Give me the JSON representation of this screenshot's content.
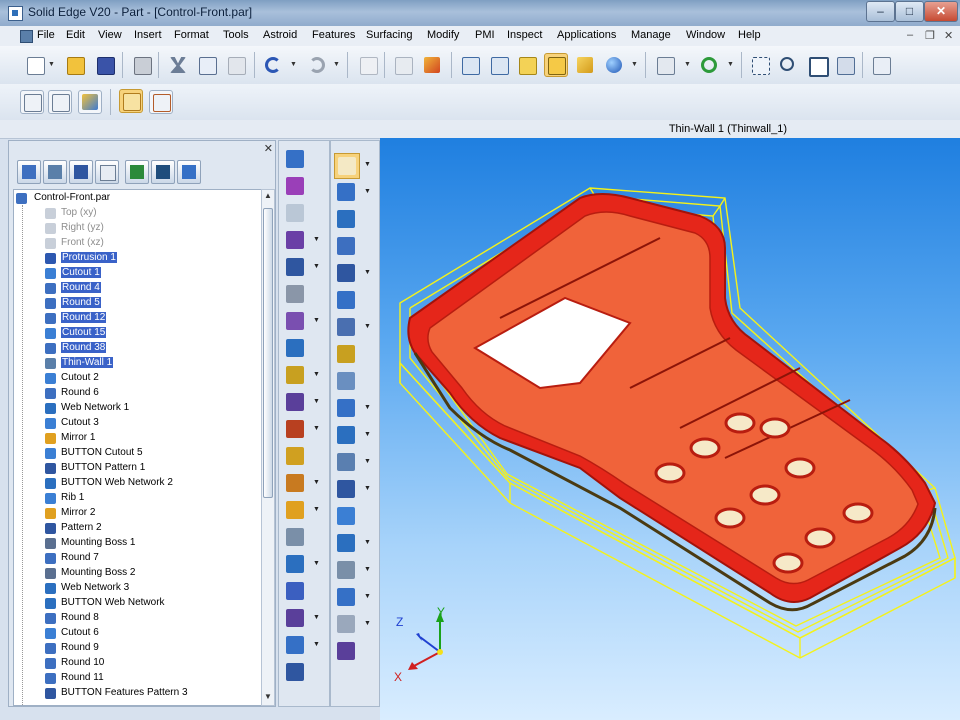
{
  "window": {
    "title": "Solid Edge V20 - Part - [Control-Front.par]",
    "minimize": "–",
    "maximize": "□",
    "close": "✕"
  },
  "menubar": {
    "items": [
      "File",
      "Edit",
      "View",
      "Insert",
      "Format",
      "Tools",
      "Astroid",
      "Features",
      "Surfacing",
      "Modify",
      "PMI",
      "Inspect",
      "Applications",
      "Manage",
      "Window",
      "Help"
    ],
    "mdi_minimize": "–",
    "mdi_restore": "❐",
    "mdi_close": "✕"
  },
  "toolbar_main": {
    "icons": [
      "new-icon",
      "open-icon",
      "save-icon",
      "print-icon",
      "cut-icon",
      "copy-icon",
      "paste-icon",
      "undo-icon",
      "redo-icon",
      "select-icon",
      "part-icon",
      "feature-icon",
      "view-front-icon",
      "view-iso-icon",
      "shaded-icon",
      "shaded-edges-icon",
      "render-icon",
      "view-orient-icon",
      "rotate-icon",
      "zoom-area-icon",
      "zoom-icon",
      "fit-icon",
      "pan-icon",
      "help-icon"
    ]
  },
  "toolbar_secondary": {
    "icons": [
      "sketch-text-icon",
      "sketch-line-icon",
      "sketch-relate-icon",
      "feature-library-icon",
      "family-members-icon"
    ]
  },
  "status_strip": {
    "selection_label": "Thin-Wall 1 (Thinwall_1)"
  },
  "pathfinder": {
    "close": "✕",
    "tabs": [
      "edgebar-feature-icon",
      "layers-icon",
      "sensors-icon",
      "library-icon",
      "family-icon",
      "groups-icon",
      "features-icon"
    ],
    "tree": [
      {
        "label": "Control-Front.par",
        "state": "root",
        "icon": "part-icon"
      },
      {
        "label": "Top (xy)",
        "state": "dim",
        "icon": "plane-icon"
      },
      {
        "label": "Right (yz)",
        "state": "dim",
        "icon": "plane-icon"
      },
      {
        "label": "Front (xz)",
        "state": "dim",
        "icon": "plane-icon"
      },
      {
        "label": "Protrusion 1",
        "state": "sel",
        "icon": "protrusion-icon"
      },
      {
        "label": "Cutout 1",
        "state": "sel",
        "icon": "cutout-icon"
      },
      {
        "label": "Round 4",
        "state": "sel",
        "icon": "round-icon"
      },
      {
        "label": "Round 5",
        "state": "sel",
        "icon": "round-icon"
      },
      {
        "label": "Round 12",
        "state": "sel",
        "icon": "round-icon"
      },
      {
        "label": "Cutout 15",
        "state": "sel",
        "icon": "cutout-icon"
      },
      {
        "label": "Round 38",
        "state": "sel",
        "icon": "round-icon"
      },
      {
        "label": "Thin-Wall 1",
        "state": "sel",
        "icon": "thinwall-icon"
      },
      {
        "label": "Cutout 2",
        "state": "normal",
        "icon": "cutout-icon"
      },
      {
        "label": "Round 6",
        "state": "normal",
        "icon": "round-icon"
      },
      {
        "label": "Web Network 1",
        "state": "normal",
        "icon": "web-icon"
      },
      {
        "label": "Cutout 3",
        "state": "normal",
        "icon": "cutout-icon"
      },
      {
        "label": "Mirror 1",
        "state": "normal",
        "icon": "mirror-icon"
      },
      {
        "label": "BUTTON Cutout 5",
        "state": "normal",
        "icon": "cutout-icon"
      },
      {
        "label": "BUTTON Pattern 1",
        "state": "normal",
        "icon": "pattern-icon"
      },
      {
        "label": "BUTTON Web Network 2",
        "state": "normal",
        "icon": "web-icon"
      },
      {
        "label": "Rib 1",
        "state": "normal",
        "icon": "rib-icon"
      },
      {
        "label": "Mirror 2",
        "state": "normal",
        "icon": "mirror-icon"
      },
      {
        "label": "Pattern 2",
        "state": "normal",
        "icon": "pattern-icon"
      },
      {
        "label": "Mounting Boss 1",
        "state": "normal",
        "icon": "boss-icon"
      },
      {
        "label": "Round 7",
        "state": "normal",
        "icon": "round-icon"
      },
      {
        "label": "Mounting Boss 2",
        "state": "normal",
        "icon": "boss-icon"
      },
      {
        "label": "Web Network 3",
        "state": "normal",
        "icon": "web-icon"
      },
      {
        "label": "BUTTON Web Network",
        "state": "normal",
        "icon": "web-icon"
      },
      {
        "label": "Round 8",
        "state": "normal",
        "icon": "round-icon"
      },
      {
        "label": "Cutout 6",
        "state": "normal",
        "icon": "cutout-icon"
      },
      {
        "label": "Round 9",
        "state": "normal",
        "icon": "round-icon"
      },
      {
        "label": "Round 10",
        "state": "normal",
        "icon": "round-icon"
      },
      {
        "label": "Round 11",
        "state": "normal",
        "icon": "round-icon"
      },
      {
        "label": "BUTTON Features Pattern 3",
        "state": "normal",
        "icon": "pattern-icon"
      }
    ]
  },
  "command_bar_features": {
    "icons": [
      "protrusion-icon",
      "revolved-protrusion-icon",
      "hole-icon",
      "cutout-icon",
      "revolved-cutout-icon",
      "round-icon",
      "chamfer-icon",
      "draft-icon",
      "thin-wall-icon",
      "rib-icon",
      "web-network-icon",
      "lip-icon",
      "vent-icon",
      "mounting-boss-icon",
      "thread-icon",
      "pattern-icon",
      "mirror-icon",
      "add-body-icon",
      "thicken-icon",
      "part-copy-icon"
    ]
  },
  "command_bar_tools": {
    "icons": [
      "select-tool-icon",
      "sketch-icon",
      "coordinate-system-icon",
      "plane-icon",
      "parallel-plane-icon",
      "angled-plane-icon",
      "perpendicular-plane-icon",
      "extruded-surface-icon",
      "revolved-surface-icon",
      "swept-surface-icon",
      "bounded-surface-icon",
      "offset-surface-icon",
      "copy-surface-icon",
      "extend-surface-icon",
      "trim-surface-icon",
      "stitch-icon",
      "axis-triad-icon",
      "curve-icon",
      "split-icon"
    ]
  },
  "triad": {
    "x": "X",
    "y": "Y",
    "z": "Z"
  },
  "colors": {
    "selection": "#3a62c8",
    "model_red": "#e5261a",
    "model_yellow": "#f4f21a",
    "viewport_top": "#1f7fe0",
    "viewport_bottom": "#d9edff"
  }
}
